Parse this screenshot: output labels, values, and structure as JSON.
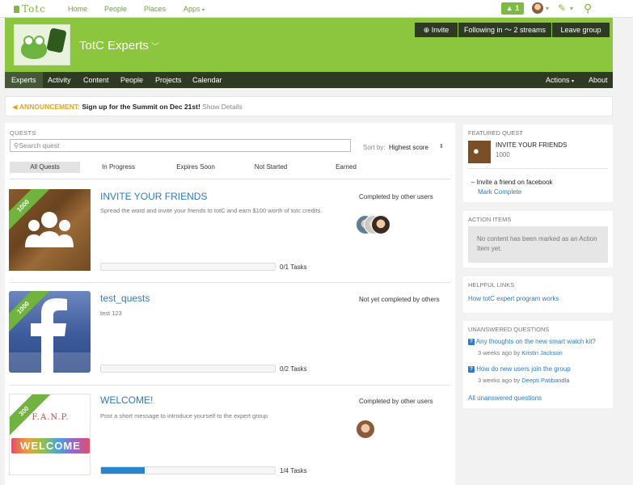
{
  "top_nav": {
    "logo": "Totc",
    "links": [
      "Home",
      "People",
      "Places",
      "Apps"
    ],
    "notification_count": "1"
  },
  "banner": {
    "group_title": "TotC Experts",
    "invite_label": "Invite",
    "following_label": "Following in",
    "streams_label": "2 streams",
    "leave_label": "Leave group"
  },
  "sub_nav": {
    "tabs": [
      "Experts",
      "Activity",
      "Content",
      "People",
      "Projects",
      "Calendar"
    ],
    "actions_label": "Actions",
    "about_label": "About"
  },
  "announcement": {
    "label": "ANNOUNCEMENT:",
    "message": "Sign up for the Summit on Dec 21st!",
    "more": "Show Details"
  },
  "quests": {
    "section_title": "QUESTS",
    "search_placeholder": "Search quest",
    "sort_label": "Sort by:",
    "sort_value": "Highest score",
    "filters": [
      "All Quests",
      "In Progress",
      "Expires Soon",
      "Not Started",
      "Earned"
    ],
    "items": [
      {
        "points": "1000",
        "title": "INVITE YOUR FRIENDS",
        "description": "Spread the word and invite your friends to totC and earn $100 worth of totc credits.",
        "status": "Completed by other users",
        "progress": 0,
        "tasks": "0/1 Tasks",
        "image_icon": "people-icon"
      },
      {
        "points": "1000",
        "title": "test_quests",
        "description": "test 123",
        "status": "Not yet completed by others",
        "progress": 0,
        "tasks": "0/2 Tasks",
        "image_icon": "facebook-icon"
      },
      {
        "points": "300",
        "title": "WELCOME!",
        "description": "Post a short message to introduce yourself to the expert group",
        "status": "Completed by other users",
        "progress": 0.25,
        "tasks": "1/4 Tasks",
        "image_icon": "welcome-image",
        "image_text_top": "F.A.N.P.",
        "image_text_main": "WELCOME"
      }
    ]
  },
  "featured_quest": {
    "section_title": "FEATURED QUEST",
    "title": "INVITE YOUR FRIENDS",
    "points": "1000",
    "task": "Invite a friend on facebook",
    "action": "Mark Complete"
  },
  "action_items": {
    "section_title": "ACTION ITEMS",
    "empty_message": "No content has been marked as an Action Item yet."
  },
  "helpful_links": {
    "section_title": "HELPFUL LINKS",
    "links": [
      "How totC expert program works"
    ]
  },
  "unanswered": {
    "section_title": "UNANSWERED QUESTIONS",
    "items": [
      {
        "question": "Any thoughts on the new smart watch kit?",
        "age": "3 weeks ago",
        "by_label": "by",
        "author": "Kristin Jackson"
      },
      {
        "question": "How do new users join the group",
        "age": "3 weeks ago",
        "by_label": "by",
        "author": "Deepti Patibandla"
      }
    ],
    "all_link": "All unanswered questions"
  },
  "colors": {
    "brand_green": "#8cc63f",
    "dark_bar": "#2e3a24",
    "link_blue": "#2f7ac6",
    "progress_blue": "#2b86c9",
    "announcement_orange": "#f0a11a"
  }
}
